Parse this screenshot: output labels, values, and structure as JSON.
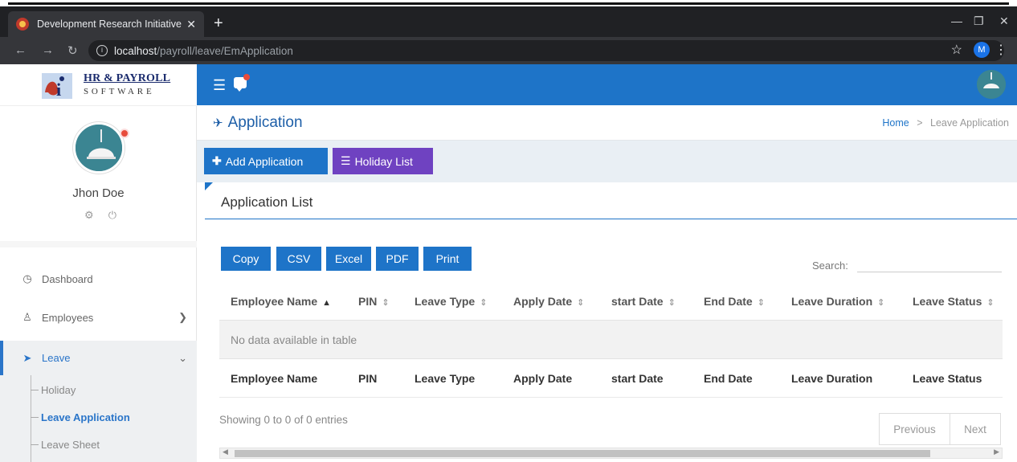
{
  "browser": {
    "tab_title": "Development Research Initiative",
    "tab_close": "✕",
    "new_tab": "+",
    "url_host": "localhost",
    "url_path": "/payroll/leave/EmApplication",
    "profile_initial": "M"
  },
  "brand": {
    "line1": "HR & PAYROLL",
    "line2": "SOFTWARE"
  },
  "profile": {
    "name": "Jhon Doe"
  },
  "sidebar": {
    "items": [
      {
        "label": "Dashboard",
        "icon": "dashboard-icon"
      },
      {
        "label": "Employees",
        "icon": "users-icon"
      },
      {
        "label": "Leave",
        "icon": "rocket-icon"
      }
    ],
    "leave_submenu": [
      "Holiday",
      "Leave Application",
      "Leave Sheet"
    ]
  },
  "page": {
    "title": "Application",
    "breadcrumb_home": "Home",
    "breadcrumb_sep": ">",
    "breadcrumb_current": "Leave Application"
  },
  "actions": {
    "add_label": "Add Application",
    "holiday_label": "Holiday List"
  },
  "card": {
    "title": "Application List"
  },
  "export_buttons": [
    "Copy",
    "CSV",
    "Excel",
    "PDF",
    "Print"
  ],
  "search": {
    "label": "Search:",
    "value": ""
  },
  "table": {
    "columns": [
      "Employee Name",
      "PIN",
      "Leave Type",
      "Apply Date",
      "start Date",
      "End Date",
      "Leave Duration",
      "Leave Status"
    ],
    "empty_message": "No data available in table",
    "info": "Showing 0 to 0 of 0 entries",
    "prev_label": "Previous",
    "next_label": "Next"
  },
  "colors": {
    "primary": "#1e74c8",
    "holiday_button": "#6f42c1",
    "status_dot": "#e74c3c"
  }
}
